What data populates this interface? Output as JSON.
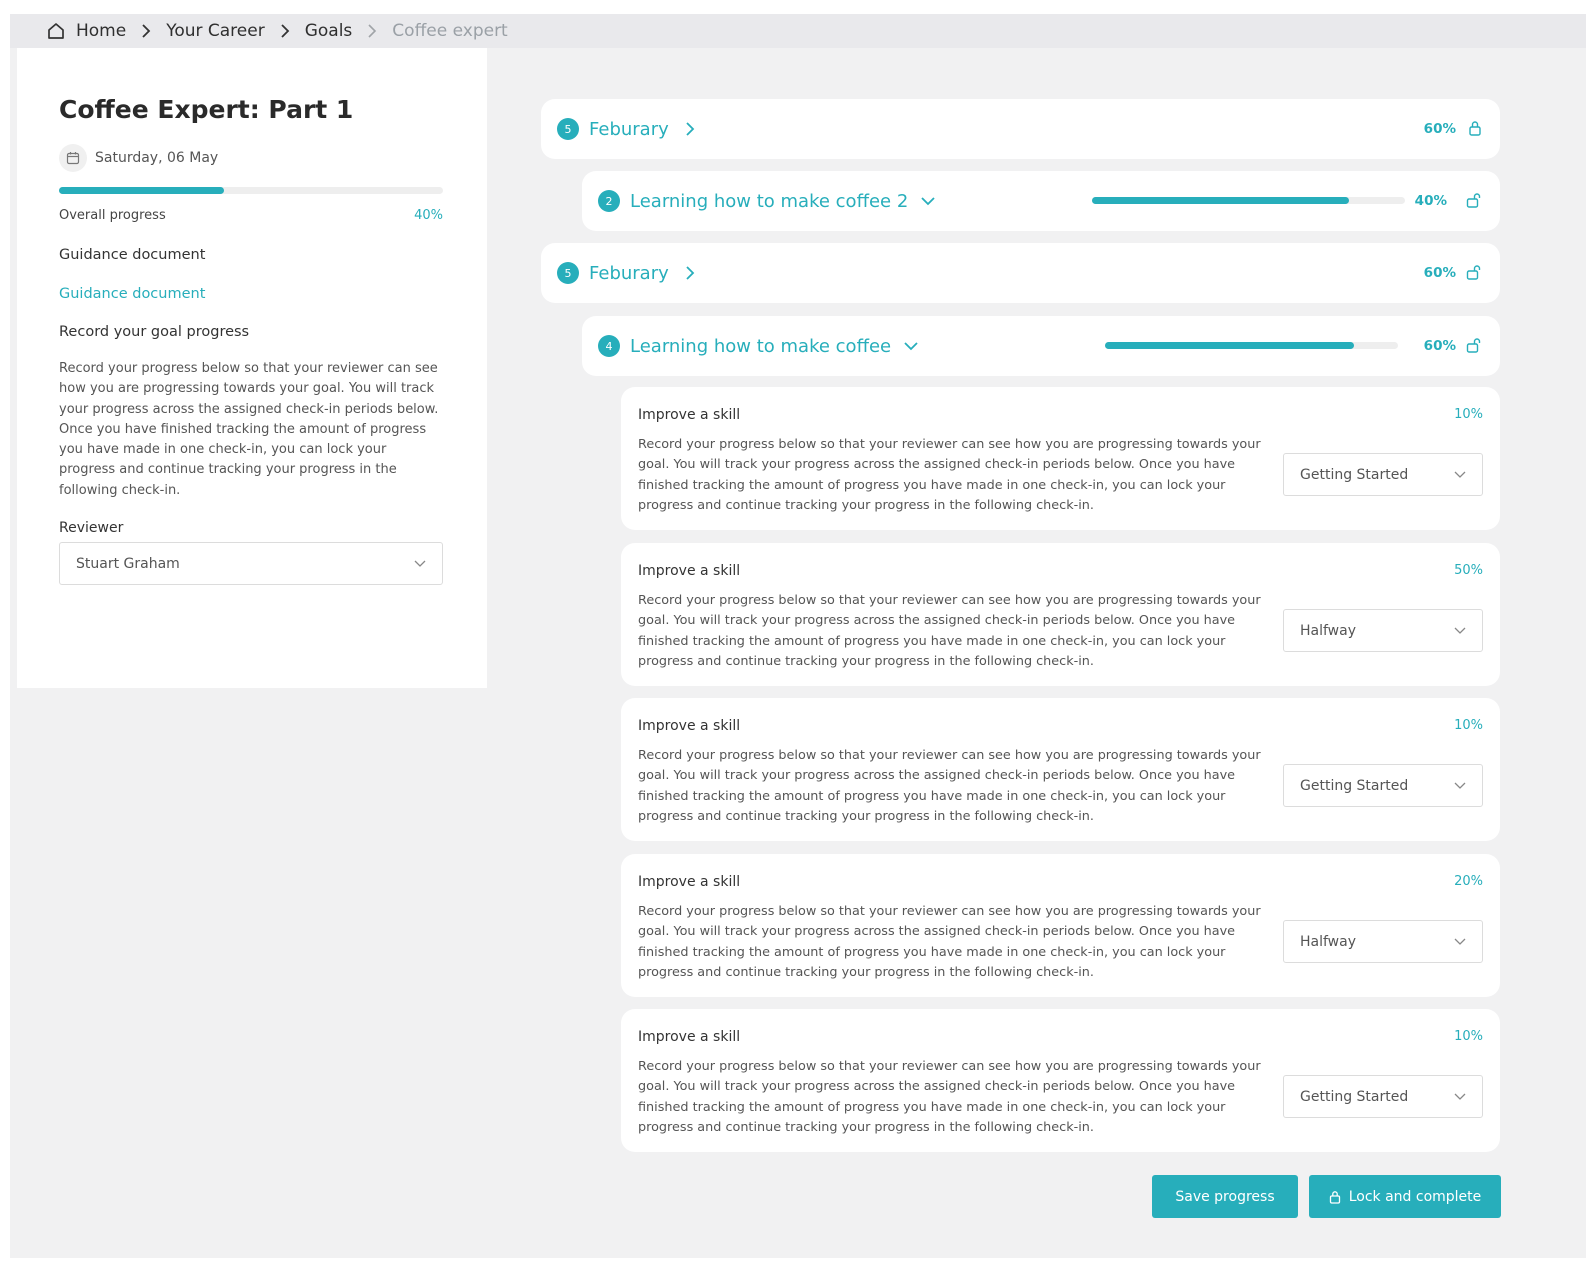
{
  "breadcrumb": {
    "items": [
      {
        "label": "Home"
      },
      {
        "label": "Your Career"
      },
      {
        "label": "Goals"
      },
      {
        "label": "Coffee expert"
      }
    ]
  },
  "left": {
    "title": "Coffee Expert: Part 1",
    "date": "Saturday, 06 May",
    "overall_progress_label": "Overall progress",
    "overall_progress_value": "40%",
    "overall_progress_fraction": 0.43,
    "guidance_heading": "Guidance document",
    "guidance_link": "Guidance document",
    "record_heading": "Record your goal progress",
    "record_body": "Record your progress below so that your reviewer can see how you are progressing towards your goal.  You will track your progress across the assigned check-in periods below.  Once you have finished tracking the amount of progress you have made in one check-in, you can lock your progress and continue tracking your progress in the following check-in.",
    "reviewer_label": "Reviewer",
    "reviewer_value": "Stuart Graham"
  },
  "periods": [
    {
      "badge": "5",
      "title": "Feburary",
      "pct": "60%"
    },
    {
      "badge": "5",
      "title": "Feburary",
      "pct": "60%"
    }
  ],
  "goals": [
    {
      "badge": "2",
      "title": "Learning how to make coffee 2",
      "pct": "40%",
      "fraction": 0.82
    },
    {
      "badge": "4",
      "title": "Learning how to make coffee",
      "pct": "60%",
      "fraction": 0.85
    }
  ],
  "skills": [
    {
      "title": "Improve a skill",
      "pct": "10%",
      "body": "Record your progress below so that your reviewer can see how you are progressing towards your goal.  You will track your progress across the assigned check-in periods below.  Once you have finished tracking the amount of progress you have made in one check-in, you can lock your progress and continue tracking your progress in the following check-in.",
      "status": "Getting Started"
    },
    {
      "title": "Improve a skill",
      "pct": "50%",
      "body": "Record your progress below so that your reviewer can see how you are progressing towards your goal.  You will track your progress across the assigned check-in periods below.  Once you have finished tracking the amount of progress you have made in one check-in, you can lock your progress and continue tracking your progress in the following check-in.",
      "status": "Halfway"
    },
    {
      "title": "Improve a skill",
      "pct": "10%",
      "body": "Record your progress below so that your reviewer can see how you are progressing towards your goal.  You will track your progress across the assigned check-in periods below.  Once you have finished tracking the amount of progress you have made in one check-in, you can lock your progress and continue tracking your progress in the following check-in.",
      "status": "Getting Started"
    },
    {
      "title": "Improve a skill",
      "pct": "20%",
      "body": "Record your progress below so that your reviewer can see how you are progressing towards your goal.  You will track your progress across the assigned check-in periods below.  Once you have finished tracking the amount of progress you have made in one check-in, you can lock your progress and continue tracking your progress in the following check-in.",
      "status": "Halfway"
    },
    {
      "title": "Improve a skill",
      "pct": "10%",
      "body": "Record your progress below so that your reviewer can see how you are progressing towards your goal.  You will track your progress across the assigned check-in periods below.  Once you have finished tracking the amount of progress you have made in one check-in, you can lock your progress and continue tracking your progress in the following check-in.",
      "status": "Getting Started"
    }
  ],
  "actions": {
    "save": "Save progress",
    "lock": "Lock and complete"
  },
  "colors": {
    "accent": "#27aebb",
    "background": "#f1f1f2",
    "card": "#ffffff"
  },
  "icons": [
    "home-icon",
    "chevron-right-icon",
    "calendar-icon",
    "chevron-down-icon",
    "lock-icon",
    "unlock-icon"
  ]
}
